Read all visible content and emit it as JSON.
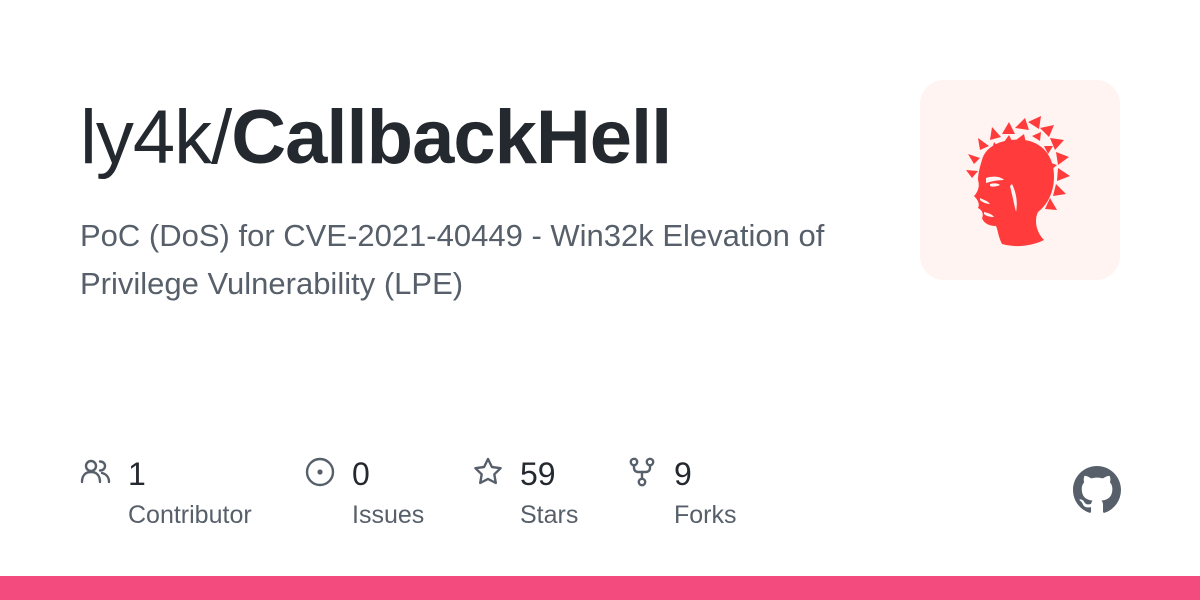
{
  "repo": {
    "owner": "ly4k/",
    "name": "CallbackHell",
    "description": "PoC (DoS) for CVE-2021-40449 - Win32k Elevation of Privilege Vulnerability (LPE)"
  },
  "avatar": {
    "icon": "red-head-profile-icon",
    "color": "#ff3b3b",
    "background": "#fff4f2"
  },
  "stats": [
    {
      "icon": "people-icon",
      "value": "1",
      "label": "Contributor"
    },
    {
      "icon": "issue-opened-icon",
      "value": "0",
      "label": "Issues"
    },
    {
      "icon": "star-icon",
      "value": "59",
      "label": "Stars"
    },
    {
      "icon": "repo-forked-icon",
      "value": "9",
      "label": "Forks"
    }
  ],
  "brand": {
    "logo": "github-mark-icon",
    "language_bar_color": "#f34b7d",
    "text_color": "#24292f",
    "muted_color": "#57606a",
    "icon_color": "#57606a"
  }
}
